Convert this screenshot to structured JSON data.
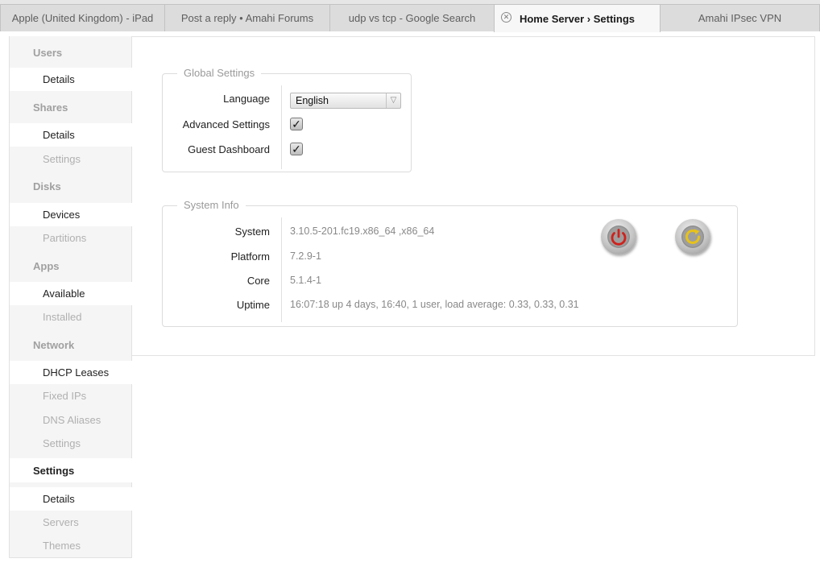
{
  "tabs": [
    {
      "label": "Apple (United Kingdom) - iPad",
      "active": false
    },
    {
      "label": "Post a reply • Amahi Forums",
      "active": false
    },
    {
      "label": "udp vs tcp - Google Search",
      "active": false
    },
    {
      "label": "Home Server › Settings",
      "active": true
    },
    {
      "label": "Amahi IPsec VPN",
      "active": false
    }
  ],
  "sidebar": {
    "users": {
      "label": "Users",
      "details": "Details"
    },
    "shares": {
      "label": "Shares",
      "details": "Details",
      "settings": "Settings"
    },
    "disks": {
      "label": "Disks",
      "devices": "Devices",
      "partitions": "Partitions"
    },
    "apps": {
      "label": "Apps",
      "available": "Available",
      "installed": "Installed"
    },
    "network": {
      "label": "Network",
      "dhcp_leases": "DHCP Leases",
      "fixed_ips": "Fixed IPs",
      "dns_aliases": "DNS Aliases",
      "settings": "Settings"
    },
    "settings": {
      "label": "Settings",
      "details": "Details",
      "servers": "Servers",
      "themes": "Themes"
    }
  },
  "global_settings": {
    "legend": "Global Settings",
    "language_label": "Language",
    "language_value": "English",
    "advanced_label": "Advanced Settings",
    "advanced_checked": true,
    "guest_label": "Guest Dashboard",
    "guest_checked": true
  },
  "system_info": {
    "legend": "System Info",
    "system_label": "System",
    "system_value": "3.10.5-201.fc19.x86_64 ,x86_64",
    "platform_label": "Platform",
    "platform_value": "7.2.9-1",
    "core_label": "Core",
    "core_value": "5.1.4-1",
    "uptime_label": "Uptime",
    "uptime_value": "16:07:18 up 4 days, 16:40, 1 user, load average: 0.33, 0.33, 0.31"
  },
  "icons": {
    "power": "power-icon",
    "restart": "restart-icon",
    "close": "close-icon",
    "checkmark": "checkmark-icon",
    "dropdown": "chevron-down-icon"
  },
  "colors": {
    "power_red": "#d0211c",
    "restart_yellow": "#e8c21a",
    "sidebar_bg": "#f5f5f5",
    "tabbar_bg": "#e6e6e6"
  }
}
